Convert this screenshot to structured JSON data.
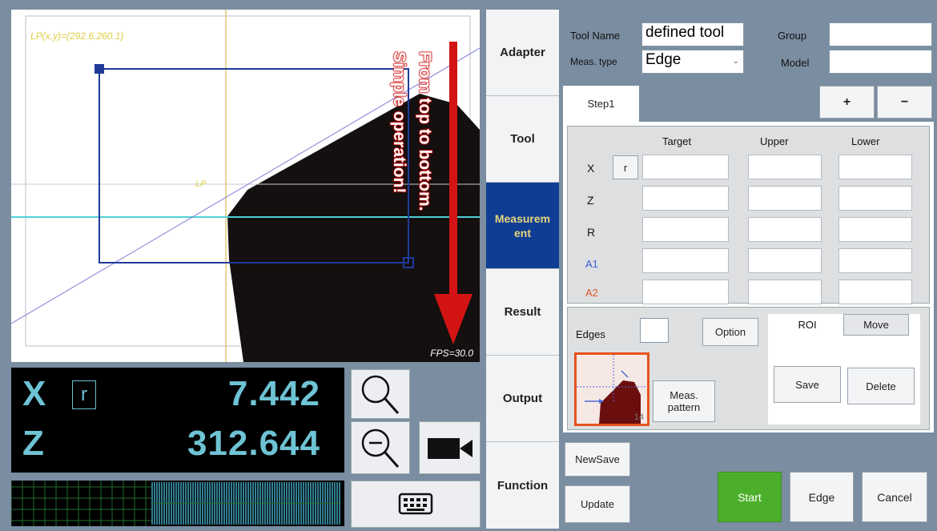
{
  "camera": {
    "lp_label": "LP(x,y)=(292.6,260.1)",
    "lp_marker": "LP",
    "fps": "FPS=30.0",
    "annotation_line1": "From top to bottom.",
    "annotation_line2": "Simple operation!"
  },
  "coords": {
    "x_axis": "X",
    "z_axis": "Z",
    "r_mode": "r",
    "x_value": "7.442",
    "z_value": "312.644"
  },
  "icons": {
    "zoom_in": "magnifier-icon",
    "zoom_out": "zoom-out-icon",
    "camera": "video-camera-icon",
    "keyboard": "keyboard-icon"
  },
  "menu": {
    "items": [
      {
        "label": "Adapter"
      },
      {
        "label": "Tool"
      },
      {
        "label": "Measurem ent"
      },
      {
        "label": "Result"
      },
      {
        "label": "Output"
      },
      {
        "label": "Function"
      }
    ],
    "active_index": 2
  },
  "tool": {
    "name_label": "Tool Name",
    "name_value": "defined tool",
    "meas_type_label": "Meas. type",
    "meas_type_value": "Edge",
    "group_label": "Group",
    "model_label": "Model",
    "group_value": "",
    "model_value": ""
  },
  "steps": {
    "tab": "Step1",
    "add_label": "+",
    "remove_label": "−"
  },
  "table": {
    "headers": [
      "Target",
      "Upper",
      "Lower"
    ],
    "rows": [
      "X",
      "Z",
      "R",
      "A1",
      "A2"
    ],
    "r_button": "r",
    "colors": {
      "A1": "#3d5bd6",
      "A2": "#e2552a"
    }
  },
  "edges": {
    "label": "Edges",
    "value": "",
    "option_label": "Option",
    "pattern_number": "14",
    "meas_pattern_label": "Meas. pattern"
  },
  "roi": {
    "tab_roi": "ROI",
    "tab_move": "Move",
    "save_label": "Save",
    "delete_label": "Delete"
  },
  "actions": {
    "new_save": "NewSave",
    "update": "Update",
    "start": "Start",
    "edge": "Edge",
    "cancel": "Cancel"
  },
  "colors": {
    "accent": "#0f3d94",
    "start": "#4caf2b",
    "readout": "#6ec3d4",
    "roi_box": "#1f3b9a"
  }
}
